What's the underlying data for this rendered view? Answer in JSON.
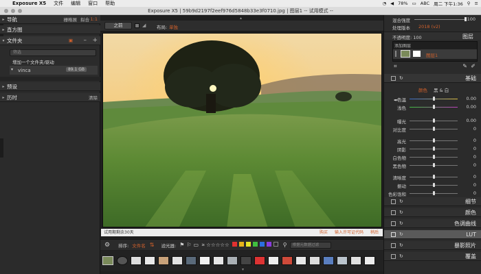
{
  "menubar": {
    "app": "Exposure X5",
    "items": [
      "文件",
      "编辑",
      "窗口",
      "帮助"
    ],
    "right": {
      "battery": "78%",
      "abc": "ABC",
      "time": "周二 下午1:36"
    }
  },
  "window": {
    "title": "Exposure X5 | 59b9d2197f2eef976d5848b33e3f0710.jpg | 图层1 -- 试用模式 --"
  },
  "left": {
    "nav": {
      "label": "导航",
      "grid": "栅格展",
      "fit": "拟合",
      "ratio": "1:1"
    },
    "histogram": "直方图",
    "folders": {
      "label": "文件夹",
      "search_placeholder": "筛选",
      "add_folder": "增加一个文件夹/驱动",
      "volume": "vinca",
      "volume_size": "89.1 GB"
    },
    "presets": "预设",
    "history": "历时",
    "clear": "清除"
  },
  "center": {
    "before_btn": "之前",
    "layout_label": "布局:",
    "layout_value": "单独",
    "status_text": "试用期剩余30天",
    "status_links": [
      "购买",
      "输入许可证代码",
      "稍后"
    ],
    "sort_label": "排序:",
    "sort_value": "文件名",
    "filter_label": "滤光器:",
    "search_placeholder": "根据元数据过滤",
    "flag_colors": [
      "#e23131",
      "#e6b31b",
      "#e5e52a",
      "#3fbf3f",
      "#2b6fe0",
      "#8a3be0"
    ]
  },
  "right": {
    "blend_label": "混合强度",
    "blend_value": "100",
    "version_label": "处理版本",
    "version_value": "2018 (v2)",
    "opacity_label": "不透明度: 100",
    "layers_label": "图层",
    "add_layer": "添加图层",
    "layer_name": "图层1",
    "basic": "基础",
    "mode_color": "颜色",
    "mode_bw": "黑 & 白",
    "sliders": [
      {
        "name": "色温",
        "value": "0.00",
        "pos": 0.5
      },
      {
        "name": "浅色",
        "value": "0.00",
        "pos": 0.5
      },
      {
        "name": "曝光",
        "value": "0.00",
        "pos": 0.5
      },
      {
        "name": "对比度",
        "value": "0",
        "pos": 0.5
      },
      {
        "name": "高光",
        "value": "0",
        "pos": 0.5
      },
      {
        "name": "阴影",
        "value": "0",
        "pos": 0.5
      },
      {
        "name": "白色物",
        "value": "0",
        "pos": 0.5
      },
      {
        "name": "黑色物",
        "value": "0",
        "pos": 0.5
      },
      {
        "name": "清晰度",
        "value": "0",
        "pos": 0.5
      },
      {
        "name": "振动",
        "value": "0",
        "pos": 0.5
      },
      {
        "name": "色彩饱和度",
        "value": "0",
        "pos": 0.5
      }
    ],
    "panels": [
      "细节",
      "颜色",
      "色调曲线",
      "LUT",
      "暴影照片",
      "覆盖"
    ]
  }
}
